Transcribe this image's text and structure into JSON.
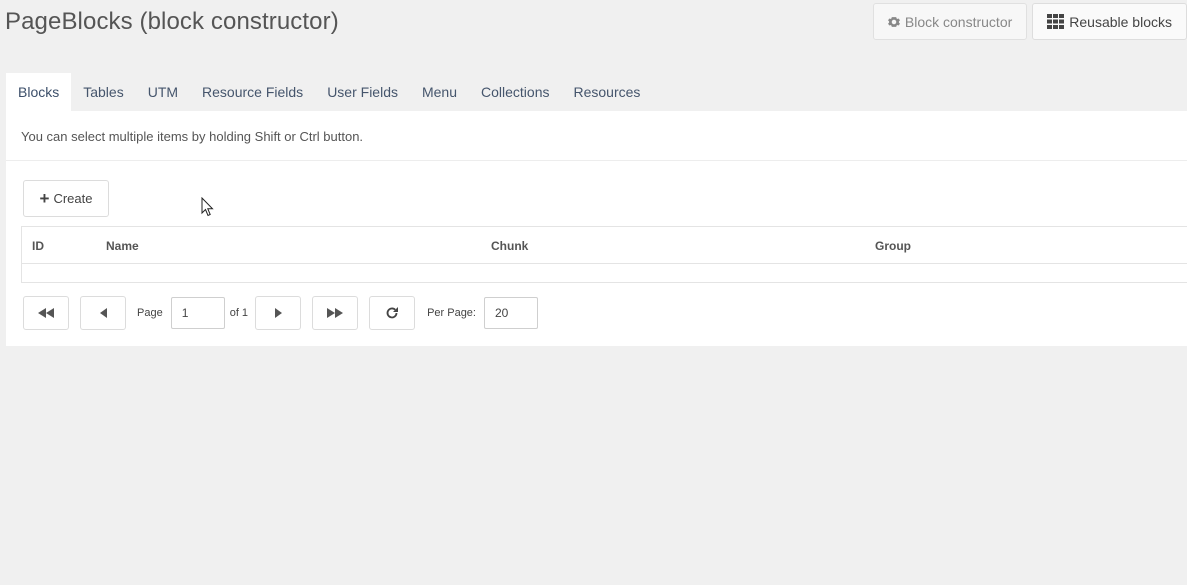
{
  "header": {
    "title": "PageBlocks (block constructor)",
    "block_constructor_label": "Block constructor",
    "reusable_blocks_label": "Reusable blocks"
  },
  "tabs": [
    {
      "label": "Blocks",
      "active": true
    },
    {
      "label": "Tables"
    },
    {
      "label": "UTM"
    },
    {
      "label": "Resource Fields"
    },
    {
      "label": "User Fields"
    },
    {
      "label": "Menu"
    },
    {
      "label": "Collections"
    },
    {
      "label": "Resources"
    }
  ],
  "panel": {
    "hint": "You can select multiple items by holding Shift or Ctrl button.",
    "create_label": "Create"
  },
  "grid": {
    "columns": [
      "ID",
      "Name",
      "Chunk",
      "Group"
    ],
    "rows": []
  },
  "pager": {
    "page_label": "Page",
    "page_value": "1",
    "of_label": "of 1",
    "per_page_label": "Per Page:",
    "per_page_value": "20"
  },
  "icons": {
    "block_constructor": "gear-icon",
    "reusable_blocks": "grid-icon",
    "create": "plus-icon",
    "first": "double-left-icon",
    "prev": "left-icon",
    "next": "right-icon",
    "last": "double-right-icon",
    "refresh": "refresh-icon"
  }
}
